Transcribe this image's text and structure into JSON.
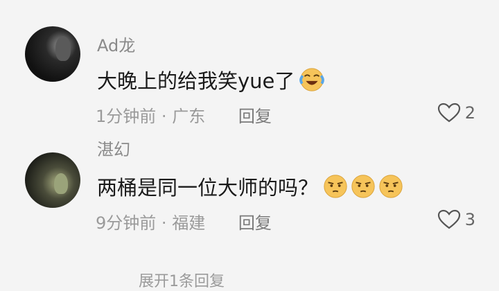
{
  "comments": [
    {
      "username": "Ad龙",
      "text": "大晚上的给我笑yue了",
      "emojis": [
        "laughing-crying-emoji"
      ],
      "time": "1分钟前",
      "sep": "·",
      "location": "广东",
      "reply": "回复",
      "likes": "2"
    },
    {
      "username": "湛幻",
      "text": "两桶是同一位大师的吗？",
      "emojis": [
        "smirk-emoji",
        "smirk-emoji",
        "smirk-emoji"
      ],
      "time": "9分钟前",
      "sep": "·",
      "location": "福建",
      "reply": "回复",
      "likes": "3"
    }
  ],
  "more": "展开1条回复",
  "colors": {
    "emoji": "#f6c45a",
    "text": "#1a1a1a",
    "muted": "#9a9a9a"
  }
}
